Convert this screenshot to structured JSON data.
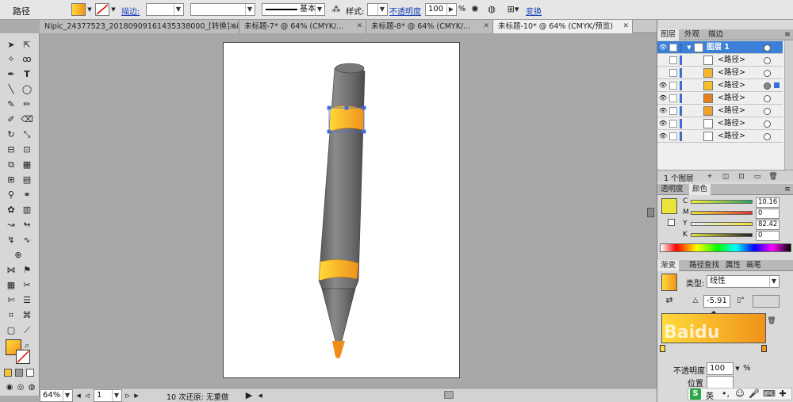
{
  "control_bar": {
    "selection_label": "路径",
    "stroke_label": "描边:",
    "basic_label": "基本",
    "style_label": "样式:",
    "opacity_label": "不透明度",
    "opacity_value": "100",
    "percent_sign": "%",
    "transform_label": "变换"
  },
  "tabs": [
    {
      "label": "Nipic_24377523_20180909161435338000_[转换].ai*"
    },
    {
      "label": "未标题-7* @ 64% (CMYK/..."
    },
    {
      "label": "未标题-8* @ 64% (CMYK/..."
    },
    {
      "label": "未标题-10* @ 64% (CMYK/预览)"
    }
  ],
  "status_bar": {
    "zoom": "64%",
    "artboard": "1",
    "undo_text": "10 次还原: 无重做"
  },
  "layers_panel": {
    "tabs": [
      "图层",
      "外观",
      "描边"
    ],
    "layer_name": "图层 1",
    "path_label": "<路径>",
    "count_label": "1 个图层"
  },
  "color_panel": {
    "tabs": [
      "透明度",
      "颜色"
    ],
    "sliders": [
      {
        "label": "C",
        "value": "10.16"
      },
      {
        "label": "M",
        "value": "0"
      },
      {
        "label": "Y",
        "value": "82.42"
      },
      {
        "label": "K",
        "value": "0"
      }
    ]
  },
  "gradient_panel": {
    "tabs": [
      "渐变",
      "路径查找",
      "属性",
      "画笔"
    ],
    "type_label": "类型:",
    "type_value": "线性",
    "angle_value": "-5.91",
    "opacity_label": "不透明度",
    "opacity_value": "100",
    "location_label": "位置"
  },
  "watermark": "Baidu",
  "ime": {
    "label": "英"
  },
  "colors": {
    "gradient_start": "#ffd93a",
    "gradient_end": "#f0921a",
    "pencil_body": "#7a7a7a",
    "pencil_tip": "#f08c18",
    "selection_blue": "#3b6fe0",
    "layer_select": "#3b7fd6"
  }
}
